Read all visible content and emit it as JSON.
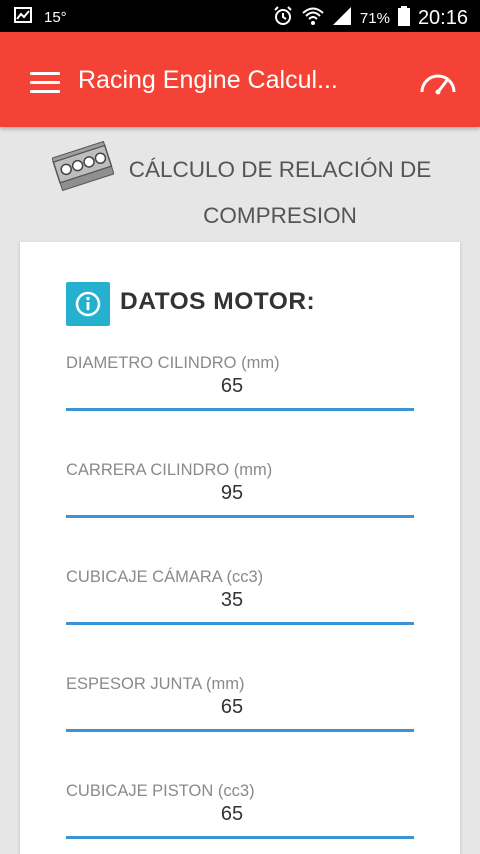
{
  "status_bar": {
    "temperature": "15°",
    "battery": "71%",
    "time": "20:16"
  },
  "app_bar": {
    "title": "Racing Engine Calcul..."
  },
  "page": {
    "title_line1": "CÁLCULO DE RELACIÓN DE",
    "title_line2": "COMPRESION"
  },
  "card": {
    "section_title": "DATOS MOTOR:",
    "fields": [
      {
        "label": "DIAMETRO CILINDRO (mm)",
        "value": "65"
      },
      {
        "label": "CARRERA CILINDRO (mm)",
        "value": "95"
      },
      {
        "label": "CUBICAJE CÁMARA (cc3)",
        "value": "35"
      },
      {
        "label": "ESPESOR JUNTA (mm)",
        "value": "65"
      },
      {
        "label": "CUBICAJE PISTON (cc3)",
        "value": "65"
      }
    ]
  },
  "colors": {
    "app_bar": "#f44336",
    "accent_line": "#3b92d4",
    "info_button": "#26b0d0"
  }
}
